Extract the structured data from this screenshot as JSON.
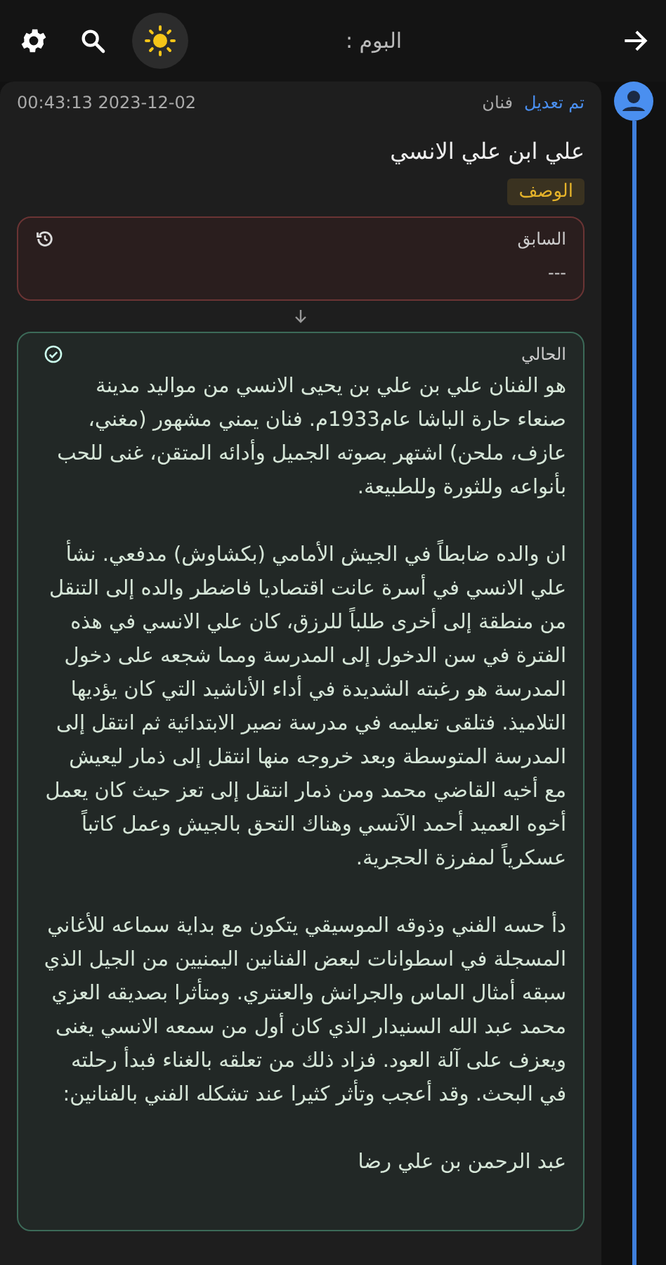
{
  "header": {
    "title": "البوم :"
  },
  "entry": {
    "action": "تم تعديل",
    "type": "فنان",
    "timestamp": "2023-12-02 00:43:13",
    "name": "علي ابن علي الانسي",
    "field": "الوصف",
    "previous": {
      "label": "السابق",
      "value": "---"
    },
    "current": {
      "label": "الحالي",
      "paragraphs": [
        "هو الفنان علي بن علي بن يحيى الانسي من مواليد مدينة صنعاء حارة الباشا عام1933م. فنان يمني مشهور (مغني، عازف، ملحن) اشتهر بصوته الجميل وأدائه المتقن، غنى للحب بأنواعه وللثورة وللطبيعة.",
        "ان والده ضابطاً في الجيش الأمامي (بكشاوش) مدفعي. نشأ علي الانسي في أسرة عانت اقتصاديا فاضطر والده إلى التنقل من منطقة إلى أخرى طلباً للرزق، كان علي الانسي في هذه الفترة في سن الدخول إلى المدرسة ومما شجعه على دخول المدرسة هو رغبته الشديدة في أداء الأناشيد التي كان يؤديها التلاميذ. فتلقى تعليمه في مدرسة نصير الابتدائية ثم انتقل إلى المدرسة المتوسطة وبعد خروجه منها انتقل إلى ذمار ليعيش مع أخيه القاضي محمد ومن ذمار انتقل إلى تعز حيث كان يعمل أخوه العميد أحمد الآنسي وهناك التحق بالجيش وعمل كاتباً عسكرياً لمفرزة الحجرية.",
        "دأ حسه الفني وذوقه الموسيقي يتكون مع بداية سماعه للأغاني المسجلة في اسطوانات لبعض الفنانين اليمنيين من الجيل الذي سبقه أمثال الماس والجرانش والعنتري. ومتأثرا بصديقه العزي محمد عبد الله السنيدار الذي كان أول من سمعه الانسي يغنى ويعزف على آلة العود. فزاد ذلك من تعلقه بالغناء فبدأ رحلته في البحث. وقد أعجب وتأثر كثيرا عند تشكله الفني بالفنانين:",
        "عبد الرحمن بن علي رضا"
      ]
    }
  }
}
